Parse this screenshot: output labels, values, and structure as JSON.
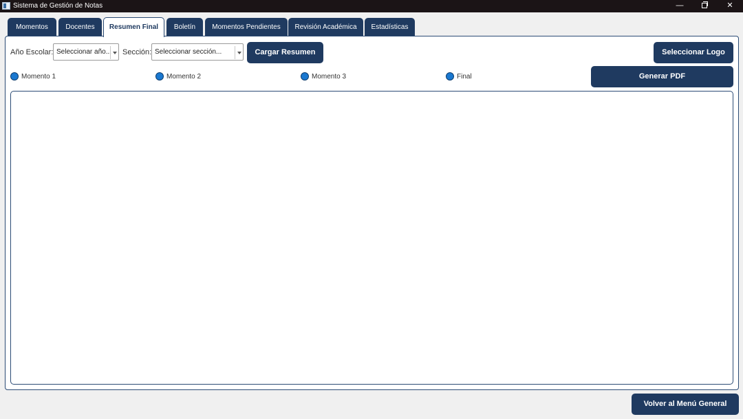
{
  "window": {
    "title": "Sistema de Gestión de Notas",
    "controls": {
      "minimize": "—",
      "close": "✕"
    }
  },
  "tabs": [
    {
      "label": "Momentos"
    },
    {
      "label": "Docentes"
    },
    {
      "label": "Resumen Final",
      "active": true
    },
    {
      "label": "Boletín"
    },
    {
      "label": "Momentos Pendientes"
    },
    {
      "label": "Revisión Académica"
    },
    {
      "label": "Estadísticas"
    }
  ],
  "filters": {
    "year_label": "Año Escolar:",
    "year_value": "Seleccionar año...",
    "section_label": "Sección:",
    "section_value": "Seleccionar sección...",
    "load_button": "Cargar Resumen"
  },
  "logo_button": "Seleccionar Logo",
  "periods": [
    {
      "label": "Momento 1"
    },
    {
      "label": "Momento 2"
    },
    {
      "label": "Momento 3"
    },
    {
      "label": "Final"
    }
  ],
  "pdf_button": "Generar PDF",
  "back_button": "Volver al Menú General",
  "colors": {
    "primary": "#1f3a60",
    "titlebar": "#1b1416",
    "radio": "#1a78d0",
    "background": "#f0f0f0"
  }
}
